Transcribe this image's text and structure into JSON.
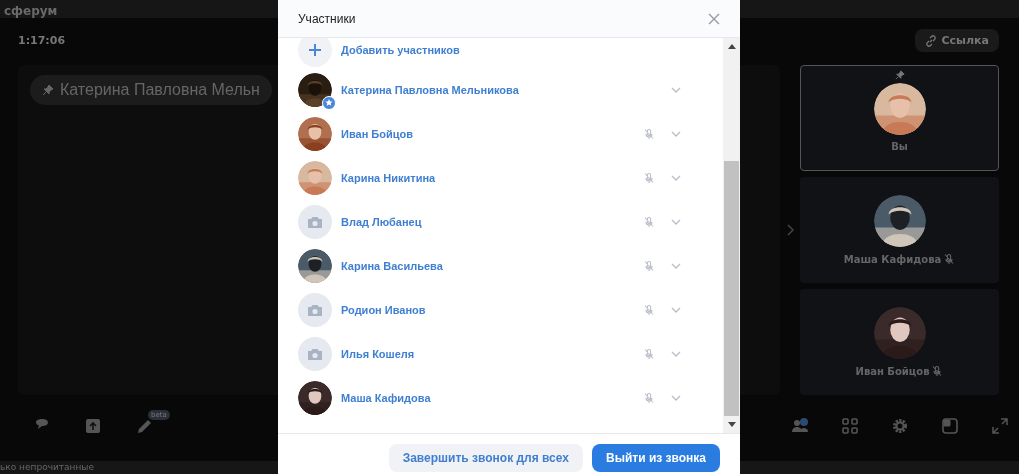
{
  "app": {
    "brand": "сферум",
    "timer": "1:17:06",
    "link_button": "Ссылка",
    "pinned_name": "Катерина Павловна Мельн",
    "beta_badge": "beta",
    "bottom_text": "ько непрочитанные"
  },
  "tiles": [
    {
      "name": "Вы",
      "pinned": true,
      "selected": true,
      "muted": false
    },
    {
      "name": "Маша Кафидова",
      "pinned": false,
      "selected": false,
      "muted": true
    },
    {
      "name": "Иван Бойцов",
      "pinned": false,
      "selected": false,
      "muted": true
    }
  ],
  "dialog": {
    "title": "Участники",
    "add_label": "Добавить участников",
    "participants": [
      {
        "name": "Катерина Павловна Мельникова",
        "has_photo": true,
        "admin": true,
        "muted": false
      },
      {
        "name": "Иван Бойцов",
        "has_photo": true,
        "admin": false,
        "muted": true
      },
      {
        "name": "Карина Никитина",
        "has_photo": true,
        "admin": false,
        "muted": true
      },
      {
        "name": "Влад Любанец",
        "has_photo": false,
        "admin": false,
        "muted": true
      },
      {
        "name": "Карина Васильева",
        "has_photo": true,
        "admin": false,
        "muted": true
      },
      {
        "name": "Родион Иванов",
        "has_photo": false,
        "admin": false,
        "muted": true
      },
      {
        "name": "Илья Кошеля",
        "has_photo": false,
        "admin": false,
        "muted": true
      },
      {
        "name": "Маша Кафидова",
        "has_photo": true,
        "admin": false,
        "muted": true
      }
    ],
    "buttons": [
      {
        "label": "Завершить звонок для всех",
        "kind": "secondary"
      },
      {
        "label": "Выйти из звонка",
        "kind": "primary"
      }
    ]
  }
}
